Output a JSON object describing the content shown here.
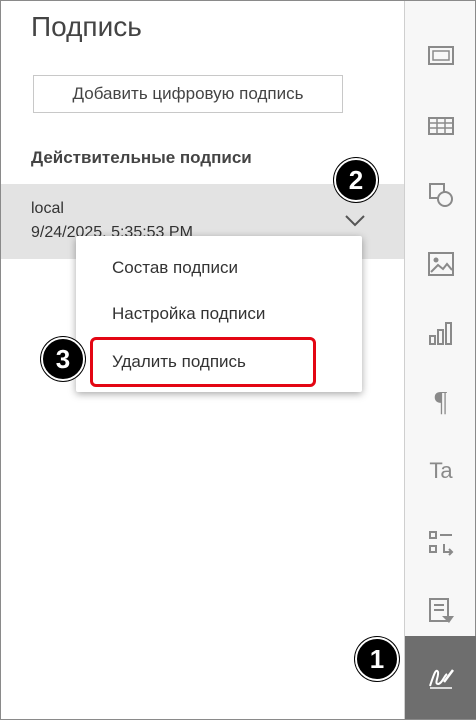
{
  "panel": {
    "title": "Подпись",
    "add_button": "Добавить цифровую подпись",
    "section_label": "Действительные подписи",
    "signature": {
      "name": "local",
      "date": "9/24/2025, 5:35:53 PM"
    }
  },
  "menu": {
    "items": [
      "Состав подписи",
      "Настройка подписи",
      "Удалить подпись"
    ]
  },
  "badges": [
    "1",
    "2",
    "3"
  ],
  "toolbar": {
    "icons": [
      "header-footer-icon",
      "table-icon",
      "shape-icon",
      "image-icon",
      "chart-icon",
      "paragraph-icon",
      "text-art-icon",
      "mail-merge-icon",
      "form-icon",
      "signature-icon"
    ],
    "paragraph_glyph": "¶",
    "textart_glyph": "Ta"
  },
  "colors": {
    "highlight": "#e30613",
    "active_tool_bg": "#6e6e6e",
    "selected_row_bg": "#e3e3e3"
  }
}
